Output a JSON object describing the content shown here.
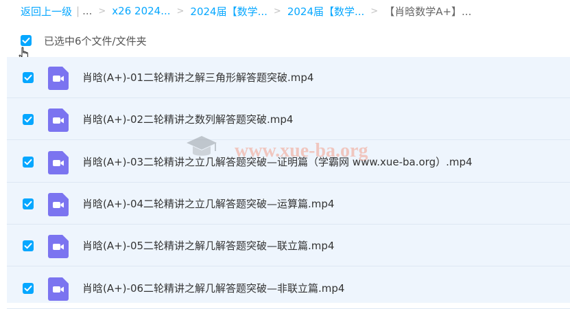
{
  "breadcrumb": {
    "back_label": "返回上一级",
    "root_ellipsis": "...",
    "items": [
      "x26 2024...",
      "2024届【数学...",
      "2024届【数学...",
      "【肖晗数学A+】..."
    ]
  },
  "selection": {
    "label": "已选中6个文件/文件夹",
    "all_checked": true
  },
  "files": [
    {
      "name": "肖晗(A+)-01二轮精讲之解三角形解答题突破.mp4",
      "checked": true
    },
    {
      "name": "肖晗(A+)-02二轮精讲之数列解答题突破.mp4",
      "checked": true
    },
    {
      "name": "肖晗(A+)-03二轮精讲之立几解答题突破—证明篇（学霸网 www.xue-ba.org）.mp4",
      "checked": true
    },
    {
      "name": "肖晗(A+)-04二轮精讲之立几解答题突破—运算篇.mp4",
      "checked": true
    },
    {
      "name": "肖晗(A+)-05二轮精讲之解几解答题突破—联立篇.mp4",
      "checked": true
    },
    {
      "name": "肖晗(A+)-06二轮精讲之解几解答题突破—非联立篇.mp4",
      "checked": true
    }
  ],
  "watermark": {
    "text": "www.xue-ba.org"
  },
  "colors": {
    "accent": "#06a7ff",
    "video_icon": "#7b74f0",
    "list_bg": "#eef5fd"
  },
  "icons": {
    "file_type": "video-file-icon",
    "checkbox": "checkmark-icon",
    "cursor": "hand-pointer-icon"
  }
}
